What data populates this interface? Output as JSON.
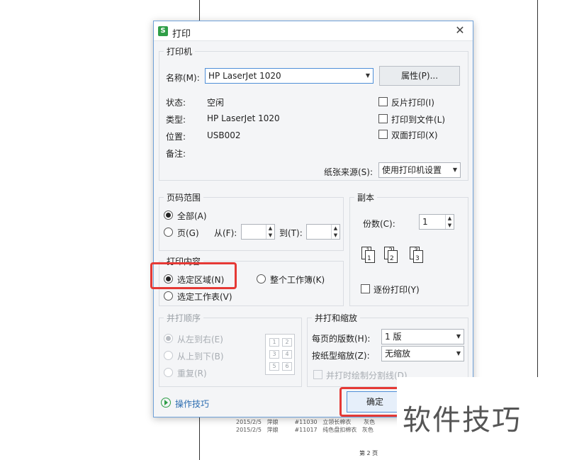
{
  "background_doc": {
    "rows": [
      {
        "date": "2015/2/5",
        "name": "萍娘",
        "code": "#11030",
        "item": "立领长棉衣",
        "color": "灰色"
      },
      {
        "date": "2015/2/5",
        "name": "萍娘",
        "code": "#11017",
        "item": "纯色盘扣棉衣",
        "color": "灰色"
      }
    ],
    "footer": "第 2 页"
  },
  "dialog": {
    "title": "打印",
    "app_icon": "S",
    "close": "✕",
    "printer": {
      "group_label": "打印机",
      "name_label": "名称(M):",
      "name_value": "HP LaserJet 1020",
      "properties_button": "属性(P)...",
      "status_label": "状态:",
      "status_value": "空闲",
      "type_label": "类型:",
      "type_value": "HP LaserJet 1020",
      "location_label": "位置:",
      "location_value": "USB002",
      "comment_label": "备注:",
      "options": [
        {
          "label": "反片打印(I)",
          "checked": false
        },
        {
          "label": "打印到文件(L)",
          "checked": false
        },
        {
          "label": "双面打印(X)",
          "checked": false
        }
      ],
      "paper_source_label": "纸张来源(S):",
      "paper_source_value": "使用打印机设置"
    },
    "page_range": {
      "group_label": "页码范围",
      "all_label": "全部(A)",
      "all_checked": true,
      "pages_label": "页(G)",
      "from_label": "从(F):",
      "to_label": "到(T):",
      "from_value": "",
      "to_value": ""
    },
    "copies": {
      "group_label": "副本",
      "count_label": "份数(C):",
      "count_value": "1",
      "collate_label": "逐份打印(Y)",
      "collate_checked": false,
      "icon_pages": [
        "1",
        "1",
        "2",
        "2",
        "3",
        "3"
      ]
    },
    "print_content": {
      "group_label": "打印内容",
      "selection_label": "选定区域(N)",
      "selection_checked": true,
      "workbook_label": "整个工作簿(K)",
      "sheet_label": "选定工作表(V)"
    },
    "collate_order": {
      "group_label": "并打顺序",
      "left_right_label": "从左到右(E)",
      "top_bottom_label": "从上到下(B)",
      "repeat_label": "重复(R)",
      "grid": [
        "1",
        "2",
        "3",
        "4",
        "5",
        "6"
      ]
    },
    "zoom": {
      "group_label": "并打和缩放",
      "pages_per_sheet_label": "每页的版数(H):",
      "pages_per_sheet_value": "1 版",
      "scale_label": "按纸型缩放(Z):",
      "scale_value": "无缩放",
      "draw_lines_label": "并打时绘制分割线(D)"
    },
    "tips_link": "操作技巧",
    "ok_button": "确定"
  },
  "watermark": "软件技巧",
  "colors": {
    "highlight": "#e53935",
    "accent": "#4f8fd8",
    "link": "#2b6cb0",
    "app_icon": "#2f9e47"
  }
}
